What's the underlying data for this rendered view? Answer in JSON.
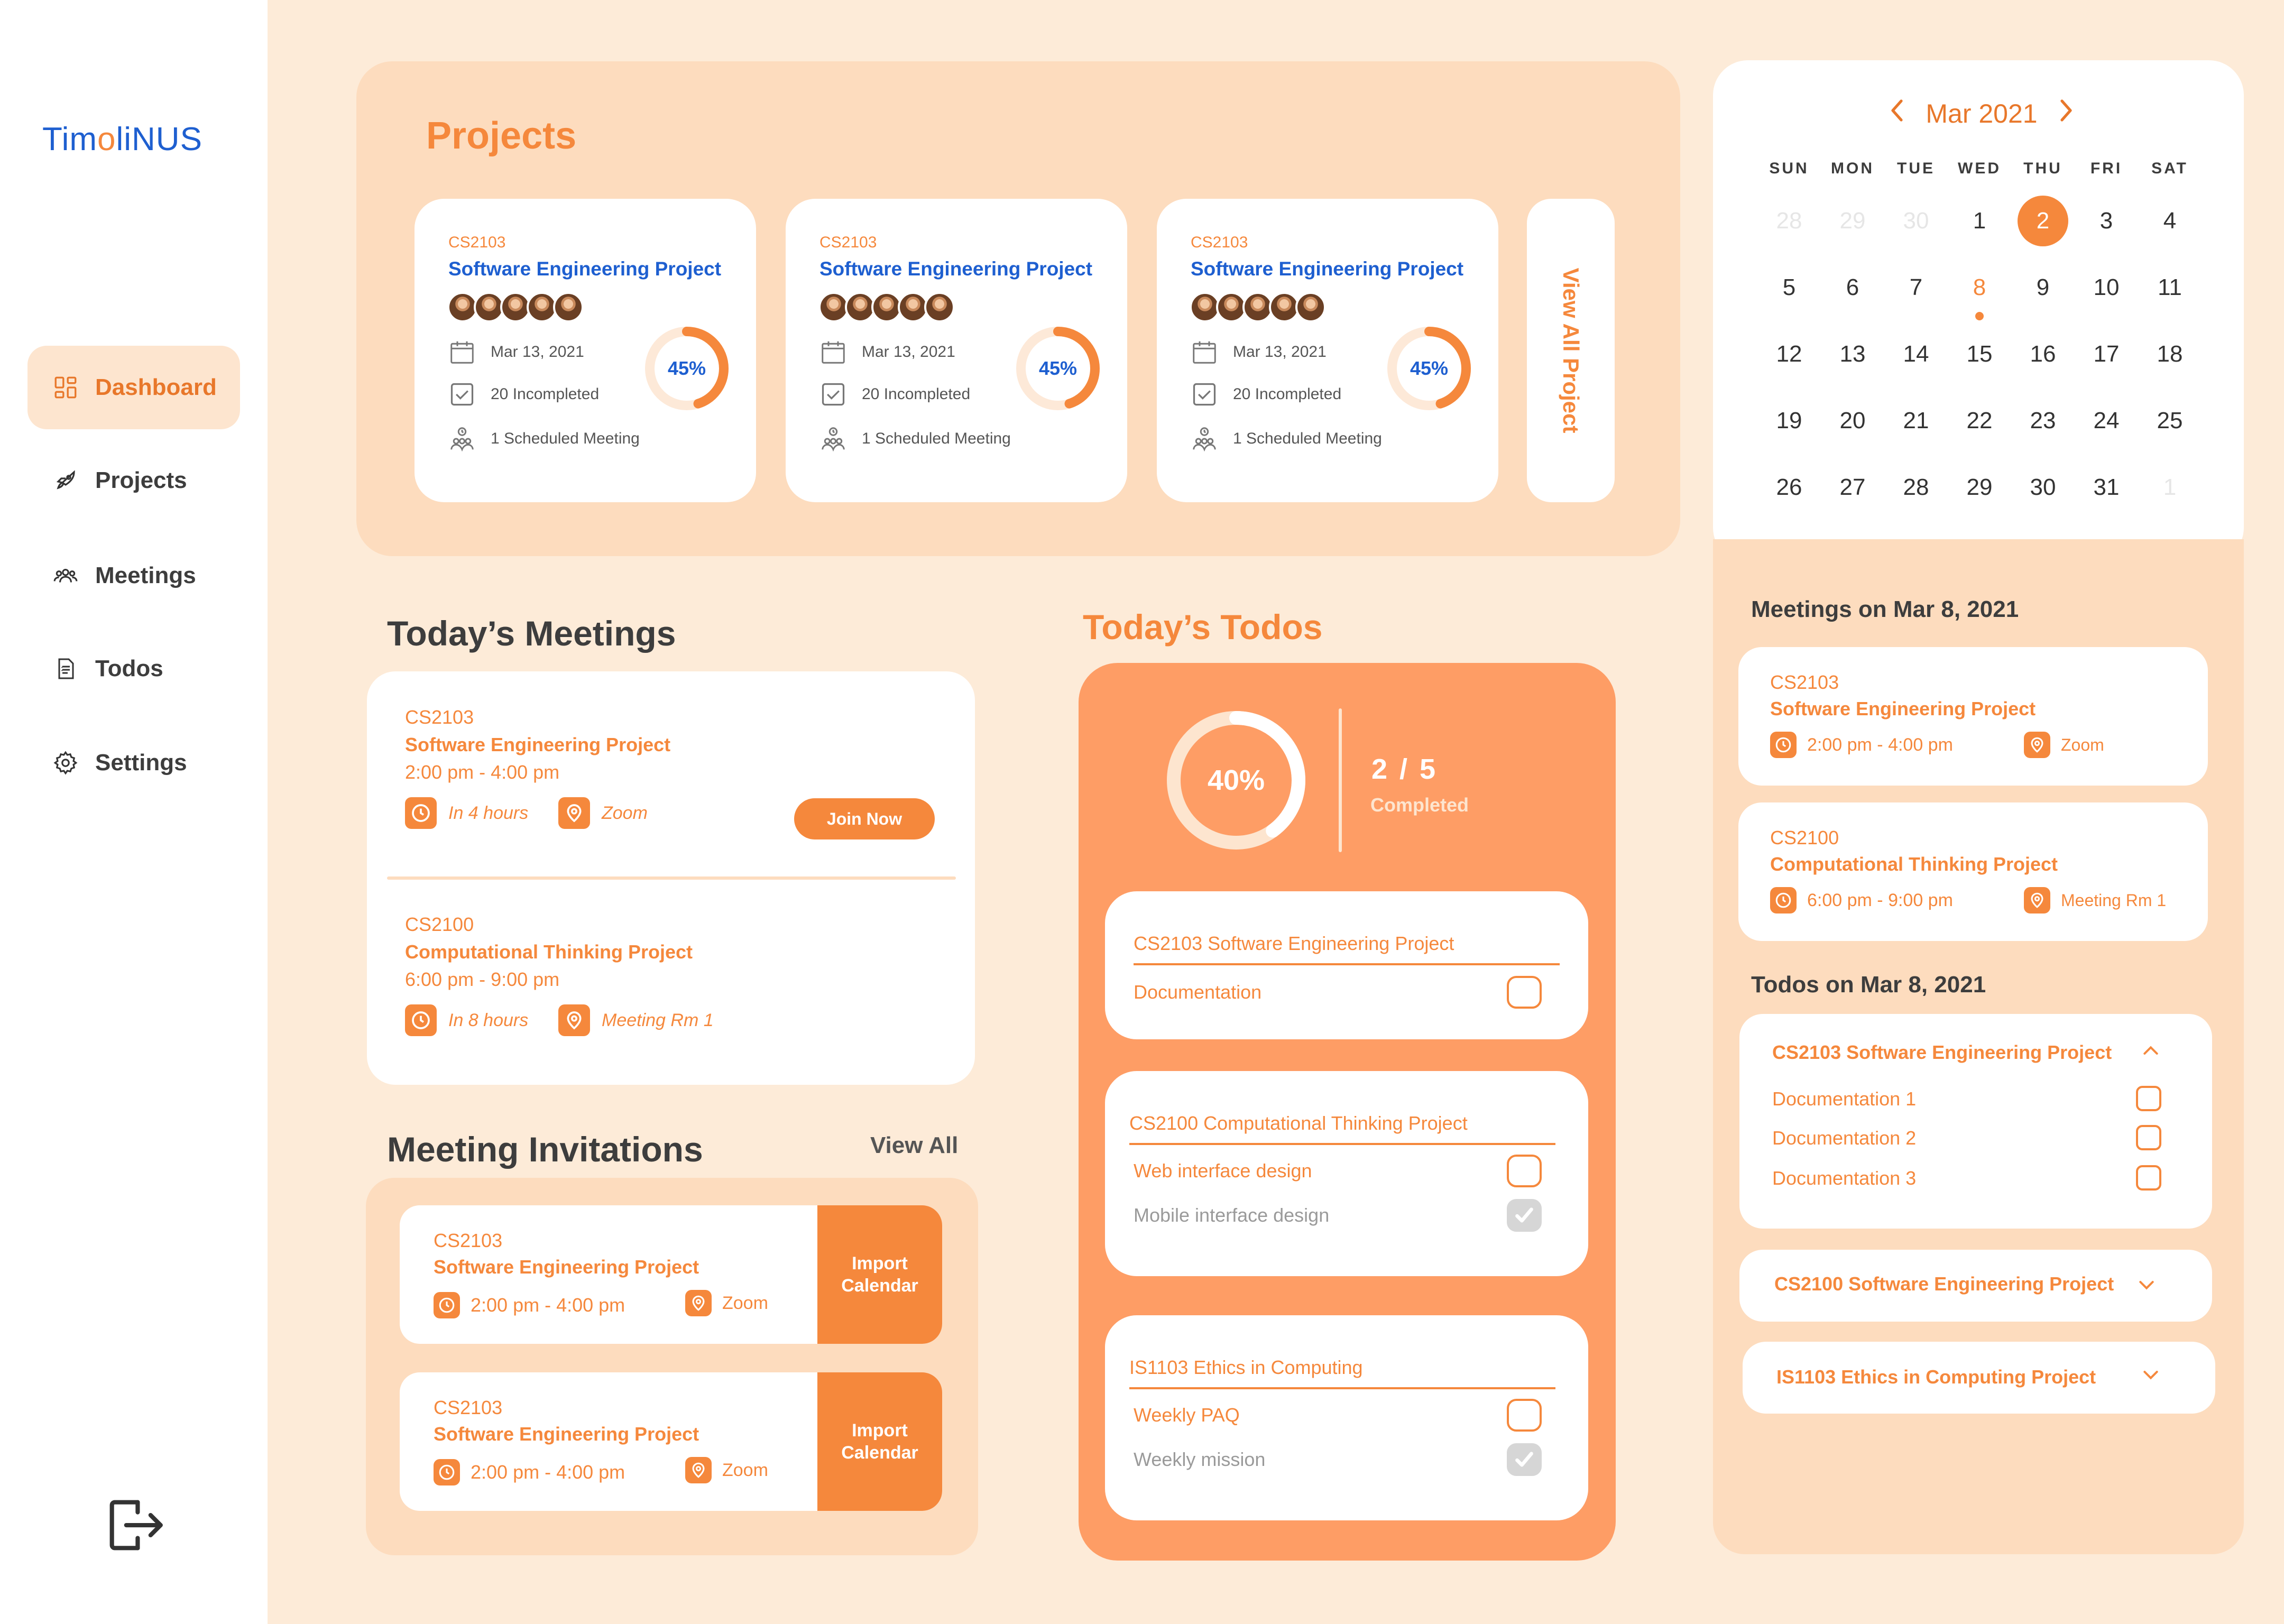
{
  "app": {
    "logo_part1": "Tim",
    "logo_part2": "o",
    "logo_part3": "liNUS"
  },
  "sidebar": {
    "items": [
      {
        "label": "Dashboard",
        "icon": "dashboard-icon",
        "active": true
      },
      {
        "label": "Projects",
        "icon": "rocket-icon"
      },
      {
        "label": "Meetings",
        "icon": "people-icon"
      },
      {
        "label": "Todos",
        "icon": "document-icon"
      },
      {
        "label": "Settings",
        "icon": "gear-icon"
      }
    ],
    "logout_icon": "logout-icon"
  },
  "projects": {
    "title": "Projects",
    "cards": [
      {
        "code": "CS2103",
        "name": "Software Engineering Project",
        "date": "Mar 13, 2021",
        "incompleted": "20 Incompleted",
        "meeting": "1 Scheduled Meeting",
        "progress": 0.45,
        "progress_label": "45%"
      },
      {
        "code": "CS2103",
        "name": "Software Engineering Project",
        "date": "Mar 13, 2021",
        "incompleted": "20 Incompleted",
        "meeting": "1 Scheduled Meeting",
        "progress": 0.45,
        "progress_label": "45%"
      },
      {
        "code": "CS2103",
        "name": "Software Engineering Project",
        "date": "Mar 13, 2021",
        "incompleted": "20 Incompleted",
        "meeting": "1 Scheduled Meeting",
        "progress": 0.45,
        "progress_label": "45%"
      }
    ],
    "view_all": "View All Project"
  },
  "calendar": {
    "month_label": "Mar 2021",
    "weekdays": [
      "SUN",
      "MON",
      "TUE",
      "WED",
      "THU",
      "FRI",
      "SAT"
    ],
    "weeks": [
      [
        "28",
        "29",
        "30",
        "1",
        "2",
        "3",
        "4"
      ],
      [
        "5",
        "6",
        "7",
        "8",
        "9",
        "10",
        "11"
      ],
      [
        "12",
        "13",
        "14",
        "15",
        "16",
        "17",
        "18"
      ],
      [
        "19",
        "20",
        "21",
        "22",
        "23",
        "24",
        "25"
      ],
      [
        "26",
        "27",
        "28",
        "29",
        "30",
        "31",
        "1"
      ]
    ],
    "selected_day": "2",
    "marked_day": "8"
  },
  "todays_meetings": {
    "title": "Today’s Meetings",
    "items": [
      {
        "code": "CS2103",
        "name": "Software Engineering Project",
        "time": "2:00 pm - 4:00 pm",
        "when": "In 4 hours",
        "location": "Zoom",
        "action": "Join Now"
      },
      {
        "code": "CS2100",
        "name": "Computational Thinking Project",
        "time": "6:00 pm - 9:00 pm",
        "when": "In 8 hours",
        "location": "Meeting Rm 1"
      }
    ]
  },
  "invitations": {
    "title": "Meeting Invitations",
    "view_all": "View All",
    "items": [
      {
        "code": "CS2103",
        "name": "Software Engineering Project",
        "time": "2:00 pm - 4:00 pm",
        "location": "Zoom",
        "action": "Import Calendar"
      },
      {
        "code": "CS2103",
        "name": "Software Engineering Project",
        "time": "2:00 pm - 4:00 pm",
        "location": "Zoom",
        "action": "Import Calendar"
      }
    ]
  },
  "todos": {
    "title": "Today’s Todos",
    "progress": 0.4,
    "progress_label": "40%",
    "fraction": "2 / 5",
    "completed_label": "Completed",
    "groups": [
      {
        "title": "CS2103 Software Engineering Project",
        "items": [
          {
            "label": "Documentation",
            "done": false
          }
        ]
      },
      {
        "title": "CS2100 Computational Thinking Project",
        "items": [
          {
            "label": "Web interface design",
            "done": false
          },
          {
            "label": "Mobile interface design",
            "done": true
          }
        ]
      },
      {
        "title": "IS1103 Ethics in Computing",
        "items": [
          {
            "label": "Weekly PAQ",
            "done": false
          },
          {
            "label": "Weekly mission",
            "done": true
          }
        ]
      }
    ]
  },
  "right": {
    "meetings_title": "Meetings on Mar 8, 2021",
    "meetings": [
      {
        "code": "CS2103",
        "name": "Software Engineering Project",
        "time": "2:00 pm - 4:00 pm",
        "location": "Zoom"
      },
      {
        "code": "CS2100",
        "name": "Computational Thinking Project",
        "time": "6:00 pm - 9:00 pm",
        "location": "Meeting Rm 1"
      }
    ],
    "todos_title": "Todos on Mar 8, 2021",
    "todo_groups": [
      {
        "title": "CS2103 Software Engineering Project",
        "expanded": true,
        "items": [
          "Documentation 1",
          "Documentation 2",
          "Documentation 3"
        ]
      },
      {
        "title": "CS2100 Software Engineering Project",
        "expanded": false
      },
      {
        "title": "IS1103 Ethics in Computing Project",
        "expanded": false
      }
    ]
  },
  "colors": {
    "accent": "#f5883c",
    "brand_blue": "#1e5fd0",
    "panel": "#fddcbe",
    "background": "#fdebd8",
    "todo_panel": "#fe9d65"
  }
}
